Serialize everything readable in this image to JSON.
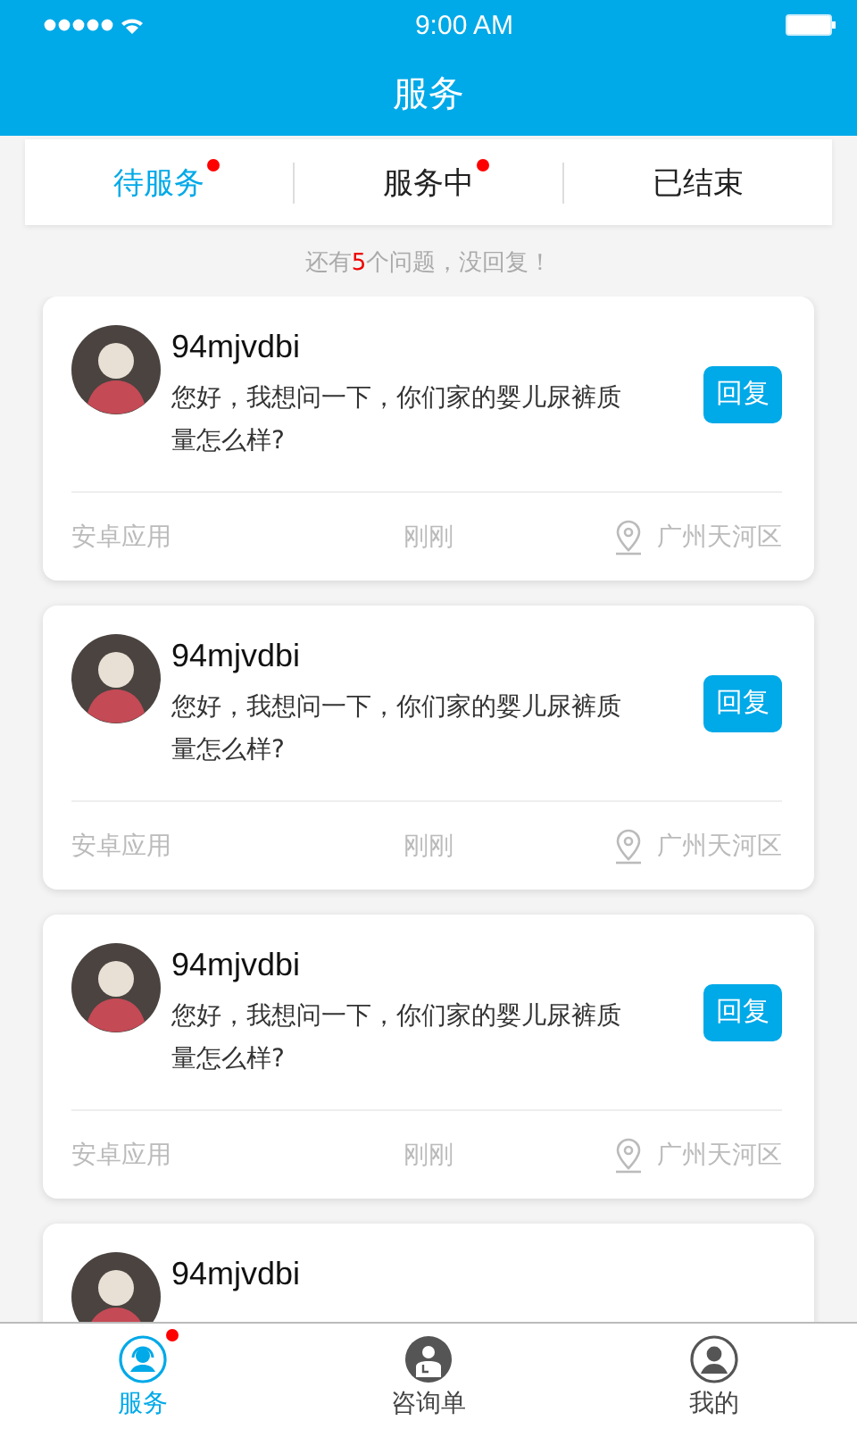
{
  "status_bar": {
    "time": "9:00 AM"
  },
  "header": {
    "title": "服务"
  },
  "tabs": [
    {
      "label": "待服务",
      "selected": true,
      "badge": true
    },
    {
      "label": "服务中",
      "selected": false,
      "badge": true
    },
    {
      "label": "已结束",
      "selected": false,
      "badge": false
    }
  ],
  "notice": {
    "prefix": "还有",
    "count": "5",
    "suffix": "个问题，没回复！"
  },
  "cards": [
    {
      "name": "94mjvdbi",
      "message": "您好，我想问一下，你们家的婴儿尿裤质量怎么样?",
      "reply": "回复",
      "source": "安卓应用",
      "time": "刚刚",
      "location": "广州天河区"
    },
    {
      "name": "94mjvdbi",
      "message": "您好，我想问一下，你们家的婴儿尿裤质量怎么样?",
      "reply": "回复",
      "source": "安卓应用",
      "time": "刚刚",
      "location": "广州天河区"
    },
    {
      "name": "94mjvdbi",
      "message": "您好，我想问一下，你们家的婴儿尿裤质量怎么样?",
      "reply": "回复",
      "source": "安卓应用",
      "time": "刚刚",
      "location": "广州天河区"
    },
    {
      "name": "94mjvdbi"
    }
  ],
  "nav": [
    {
      "kind": "service",
      "label": "服务",
      "selected": true,
      "badge": true
    },
    {
      "kind": "consult",
      "label": "咨询单",
      "selected": false,
      "badge": false
    },
    {
      "kind": "mine",
      "label": "我的",
      "selected": false,
      "badge": false
    }
  ]
}
